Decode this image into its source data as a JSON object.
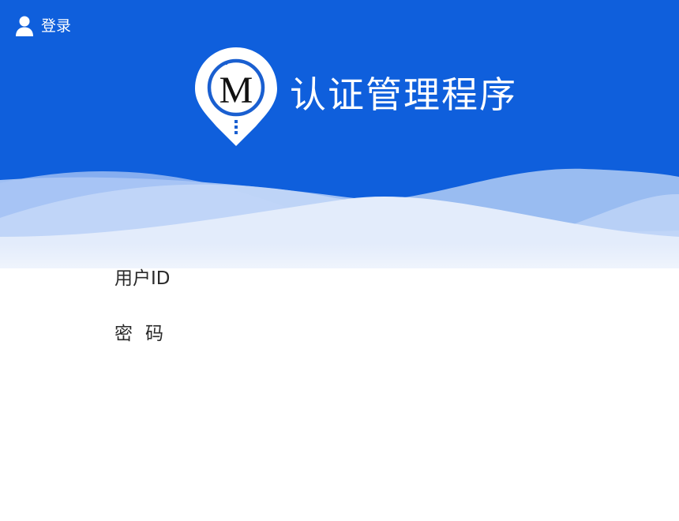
{
  "header": {
    "login_label": "登录",
    "app_title": "认证管理程序",
    "logo_letter": "M",
    "colors": {
      "primary_blue": "#0f5fdc",
      "logo_ring": "#1a5fd0",
      "white": "#ffffff"
    }
  },
  "form": {
    "user_id_label": "用户ID",
    "password_label": "密码",
    "user_id_value": "",
    "password_value": ""
  },
  "icons": {
    "login": "user-icon",
    "logo": "map-pin-logo-icon"
  }
}
